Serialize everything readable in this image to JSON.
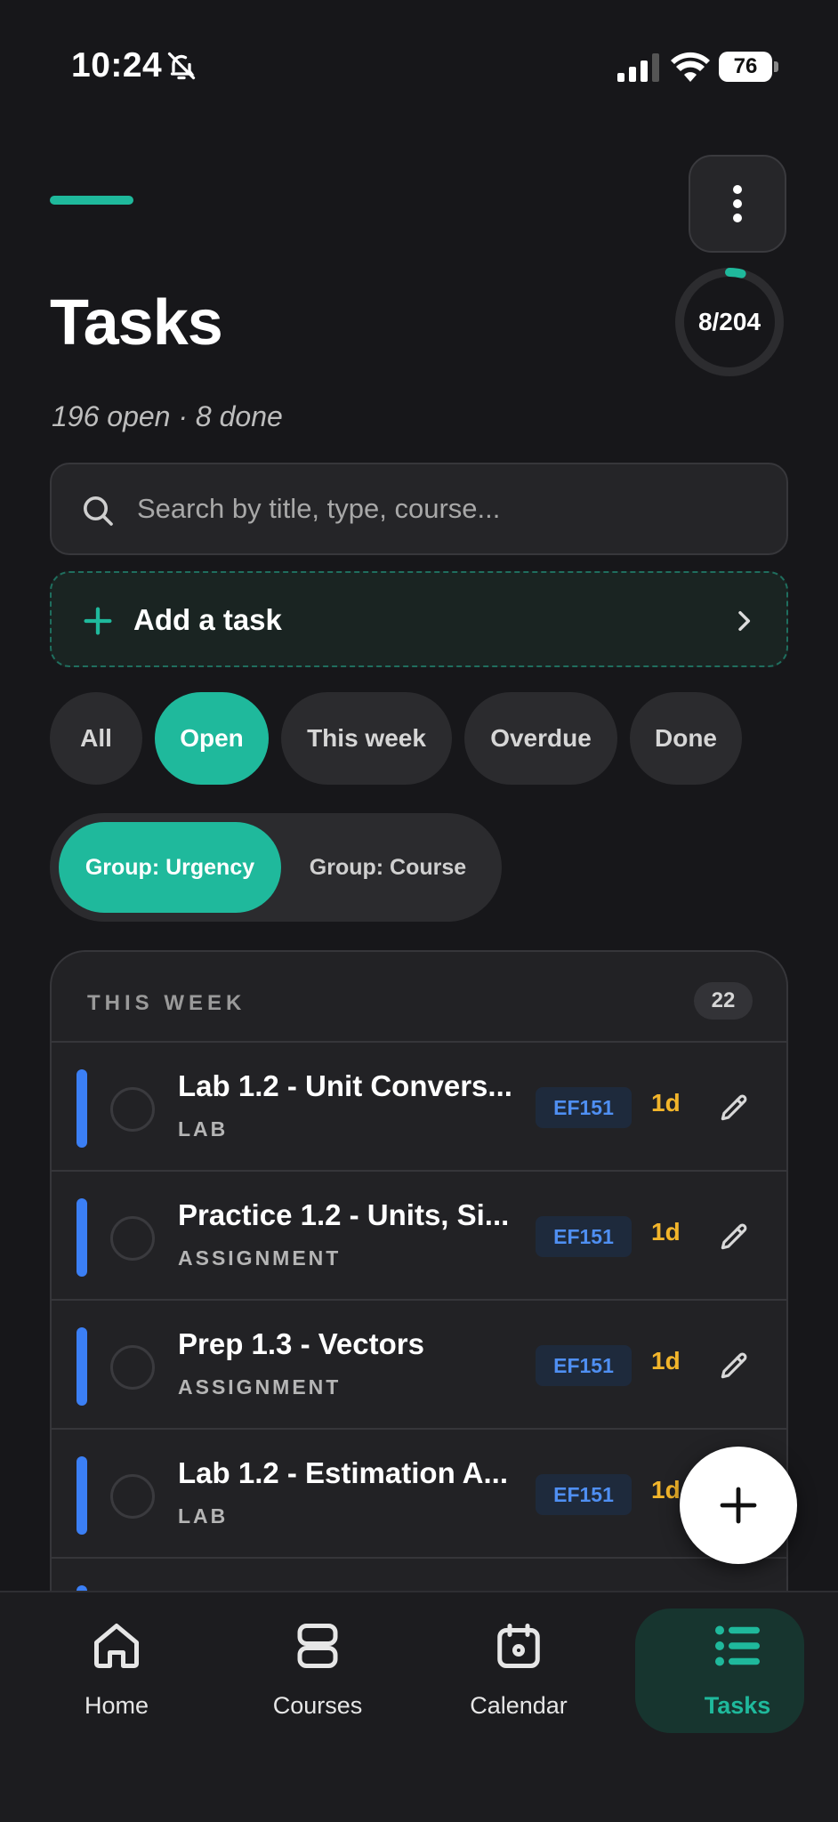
{
  "status_bar": {
    "time": "10:24",
    "battery": "76"
  },
  "header": {
    "title": "Tasks",
    "subtitle": "196 open · 8 done",
    "progress_label": "8/204",
    "progress_fraction": 0.039
  },
  "search": {
    "placeholder": "Search by title, type, course..."
  },
  "add_task": {
    "label": "Add a task"
  },
  "filters": [
    {
      "label": "All",
      "active": false
    },
    {
      "label": "Open",
      "active": true
    },
    {
      "label": "This week",
      "active": false
    },
    {
      "label": "Overdue",
      "active": false
    },
    {
      "label": "Done",
      "active": false
    }
  ],
  "grouping": [
    {
      "label": "Group: Urgency",
      "active": true
    },
    {
      "label": "Group: Course",
      "active": false
    }
  ],
  "section": {
    "title": "THIS WEEK",
    "count": "22",
    "tasks": [
      {
        "title": "Lab 1.2 - Unit Convers...",
        "type": "LAB",
        "course": "EF151",
        "due": "1d"
      },
      {
        "title": "Practice 1.2 - Units, Si...",
        "type": "ASSIGNMENT",
        "course": "EF151",
        "due": "1d"
      },
      {
        "title": "Prep 1.3 - Vectors",
        "type": "ASSIGNMENT",
        "course": "EF151",
        "due": "1d"
      },
      {
        "title": "Lab 1.2 - Estimation A...",
        "type": "LAB",
        "course": "EF151",
        "due": "1d"
      }
    ]
  },
  "tabs": [
    {
      "label": "Home",
      "icon": "home-icon",
      "active": false
    },
    {
      "label": "Courses",
      "icon": "courses-icon",
      "active": false
    },
    {
      "label": "Calendar",
      "icon": "calendar-icon",
      "active": false
    },
    {
      "label": "Tasks",
      "icon": "tasks-icon",
      "active": true
    }
  ],
  "colors": {
    "accent": "#1fb99c",
    "background": "#17171a",
    "urgency": "#3b7ff5",
    "due": "#f2b52b"
  }
}
